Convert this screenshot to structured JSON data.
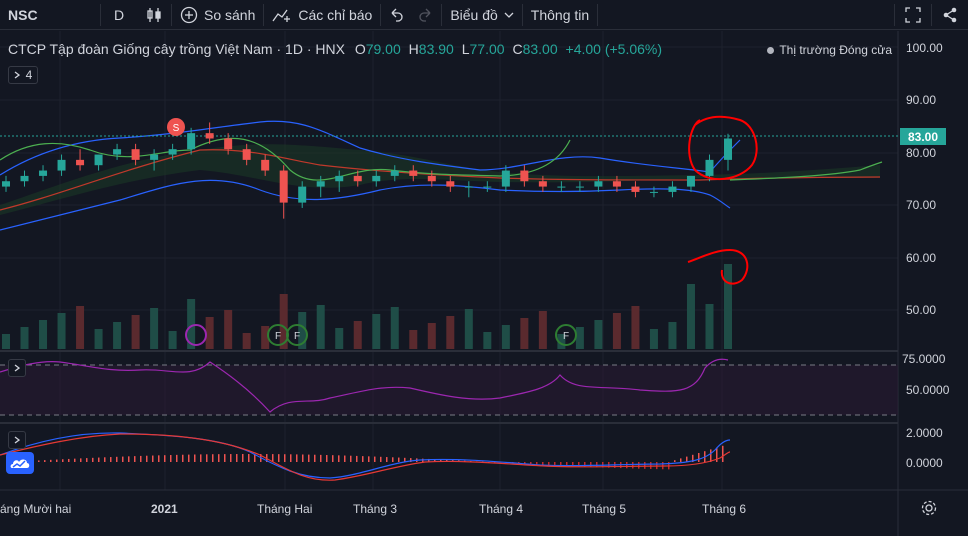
{
  "toolbar": {
    "symbol": "NSC",
    "interval": "D",
    "compare_label": "So sánh",
    "indicators_label": "Các chỉ báo",
    "chart_menu_label": "Biểu đồ",
    "info_label": "Thông tin"
  },
  "legend": {
    "title": "CTCP Tập đoàn Giống cây trồng Việt Nam · 1D · HNX",
    "o_key": "O",
    "o_val": "79.00",
    "h_key": "H",
    "h_val": "83.90",
    "l_key": "L",
    "l_val": "77.00",
    "c_key": "C",
    "c_val": "83.00",
    "change": "+4.00 (+5.06%)",
    "collapse_count": "4"
  },
  "market_status": "Thị trường Đóng cửa",
  "price_axis": [
    "100.00",
    "90.00",
    "80.00",
    "70.00",
    "60.00",
    "50.00"
  ],
  "last_price": "83.00",
  "rsi_axis": [
    "75.0000",
    "50.0000"
  ],
  "macd_axis": [
    "2.0000",
    "0.0000"
  ],
  "time_axis": [
    "áng Mười hai",
    "2021",
    "Tháng Hai",
    "Tháng 3",
    "Tháng 4",
    "Tháng 5",
    "Tháng 6"
  ],
  "event_markers": {
    "split": "S",
    "financial": "F"
  },
  "colors": {
    "up": "#26a69a",
    "down": "#ef5350",
    "bg": "#131722",
    "annotation": "#ff0000",
    "rsi": "#9c27b0",
    "macd_line": "#2962ff",
    "signal_line": "#ff6d00"
  },
  "chart_data": {
    "type": "candlestick",
    "symbol": "NSC",
    "exchange": "HNX",
    "interval": "1D",
    "ylim": [
      64,
      102
    ],
    "candles": [
      [
        74,
        76,
        73,
        75
      ],
      [
        75,
        77,
        74,
        76
      ],
      [
        76,
        78,
        75,
        77
      ],
      [
        77,
        80,
        76,
        79
      ],
      [
        79,
        81,
        77,
        78
      ],
      [
        78,
        80,
        77,
        80
      ],
      [
        80,
        82,
        79,
        81
      ],
      [
        81,
        82,
        78,
        79
      ],
      [
        79,
        81,
        77,
        80
      ],
      [
        80,
        82,
        79,
        81
      ],
      [
        81,
        85,
        80,
        84
      ],
      [
        84,
        86,
        82,
        83
      ],
      [
        83,
        84,
        80,
        81
      ],
      [
        81,
        82,
        78,
        79
      ],
      [
        79,
        80,
        76,
        77
      ],
      [
        77,
        78,
        68,
        71
      ],
      [
        71,
        75,
        70,
        74
      ],
      [
        74,
        76,
        72,
        75
      ],
      [
        75,
        77,
        73,
        76
      ],
      [
        76,
        77,
        74,
        75
      ],
      [
        75,
        77,
        74,
        76
      ],
      [
        76,
        78,
        75,
        77
      ],
      [
        77,
        78,
        75,
        76
      ],
      [
        76,
        77,
        74,
        75
      ],
      [
        75,
        76,
        73,
        74
      ],
      [
        74,
        75,
        72,
        74
      ],
      [
        74,
        75,
        73,
        74
      ],
      [
        74,
        78,
        73,
        77
      ],
      [
        77,
        78,
        74,
        75
      ],
      [
        75,
        76,
        73,
        74
      ],
      [
        74,
        75,
        73,
        74
      ],
      [
        74,
        75,
        73,
        74
      ],
      [
        74,
        76,
        73,
        75
      ],
      [
        75,
        76,
        73,
        74
      ],
      [
        74,
        75,
        72,
        73
      ],
      [
        73,
        74,
        72,
        73
      ],
      [
        73,
        75,
        72,
        74
      ],
      [
        74,
        76,
        73,
        76
      ],
      [
        76,
        80,
        75,
        79
      ],
      [
        79,
        83.9,
        77,
        83
      ]
    ],
    "volume_trend": "spike in early June",
    "annotations": [
      "red circle around last candles",
      "red circle around volume spike"
    ]
  }
}
